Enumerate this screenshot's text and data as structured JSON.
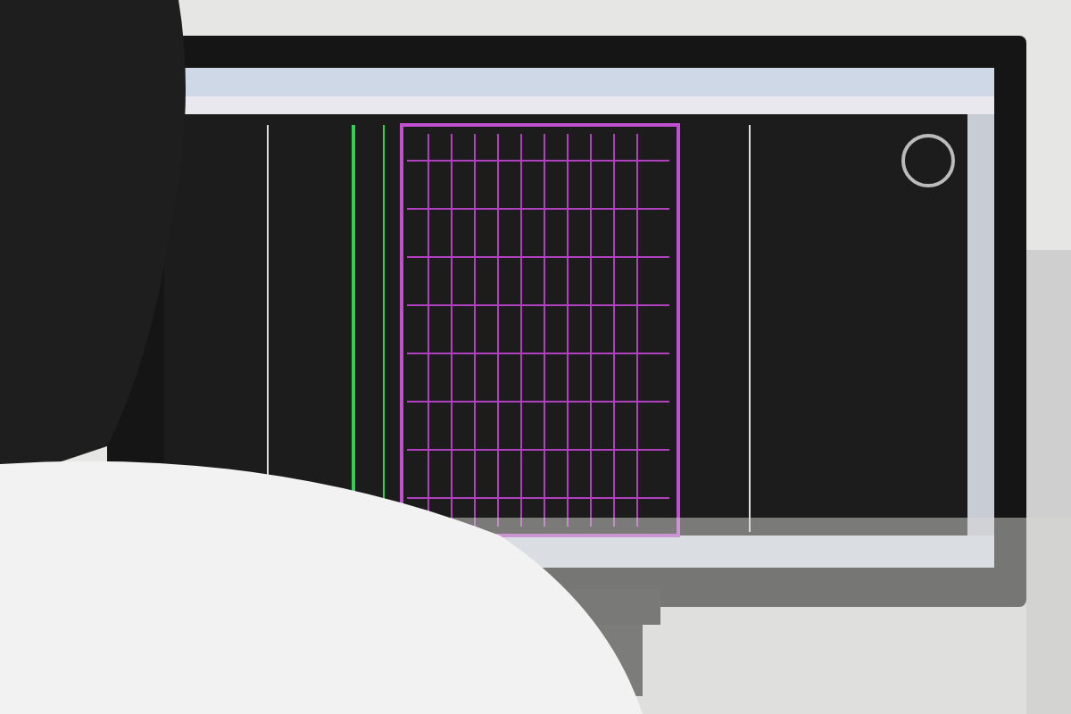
{
  "photo": {
    "kind": "photo"
  }
}
